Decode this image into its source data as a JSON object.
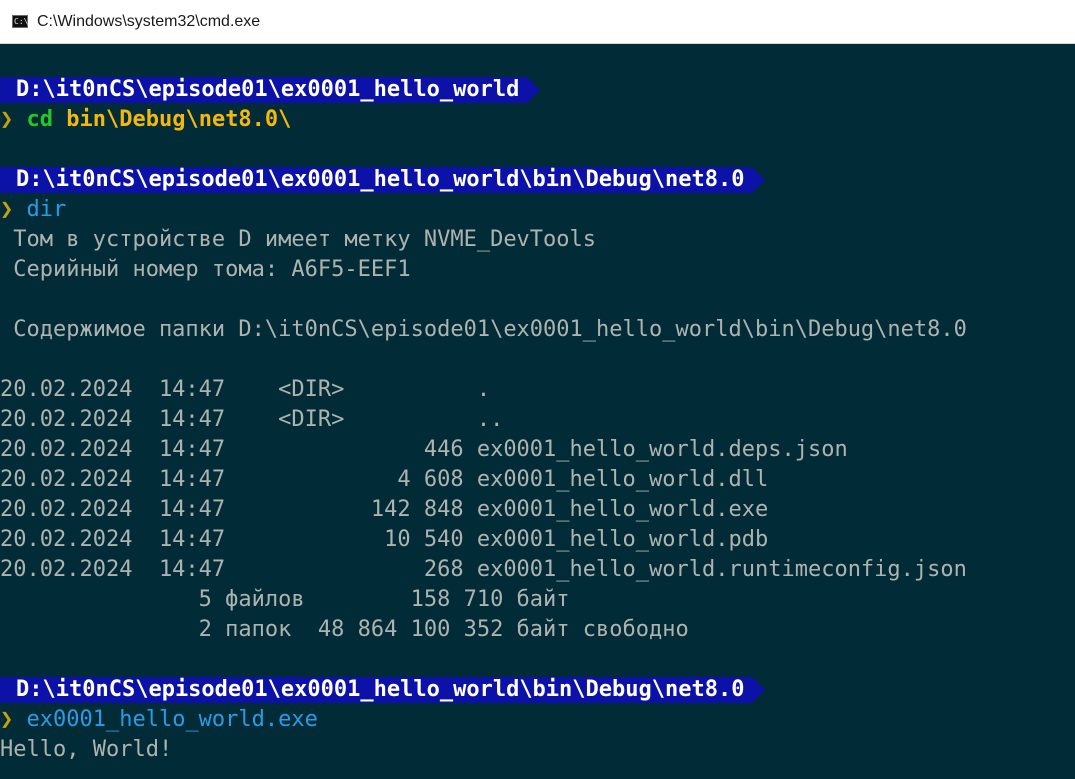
{
  "window": {
    "title": "C:\\Windows\\system32\\cmd.exe",
    "icon_text": "C:\\"
  },
  "prompt_symbol": "❯",
  "blocks": {
    "p1_path": "D:\\it0nCS\\episode01\\ex0001_hello_world",
    "p1_cmd_name": "cd",
    "p1_cmd_args": "bin\\Debug\\net8.0\\",
    "p2_path": "D:\\it0nCS\\episode01\\ex0001_hello_world\\bin\\Debug\\net8.0",
    "p2_cmd": "dir",
    "p3_path": "D:\\it0nCS\\episode01\\ex0001_hello_world\\bin\\Debug\\net8.0",
    "p3_cmd": "ex0001_hello_world.exe"
  },
  "dir_output": {
    "volume_label": " Том в устройстве D имеет метку NVME_DevTools",
    "serial": " Серийный номер тома: A6F5-EEF1",
    "contents_header": " Содержимое папки D:\\it0nCS\\episode01\\ex0001_hello_world\\bin\\Debug\\net8.0",
    "rows": [
      "20.02.2024  14:47    <DIR>          .",
      "20.02.2024  14:47    <DIR>          ..",
      "20.02.2024  14:47               446 ex0001_hello_world.deps.json",
      "20.02.2024  14:47             4 608 ex0001_hello_world.dll",
      "20.02.2024  14:47           142 848 ex0001_hello_world.exe",
      "20.02.2024  14:47            10 540 ex0001_hello_world.pdb",
      "20.02.2024  14:47               268 ex0001_hello_world.runtimeconfig.json"
    ],
    "summary_files": "               5 файлов        158 710 байт",
    "summary_dirs": "               2 папок  48 864 100 352 байт свободно"
  },
  "program_output": "Hello, World!",
  "colors": {
    "background": "#012b36",
    "path_segment": "#0c12a8",
    "text": "#aeb3b0",
    "chevron": "#c6a20a",
    "cd_command": "#25c826",
    "cd_args": "#f2b80d",
    "command": "#2a9be6"
  }
}
